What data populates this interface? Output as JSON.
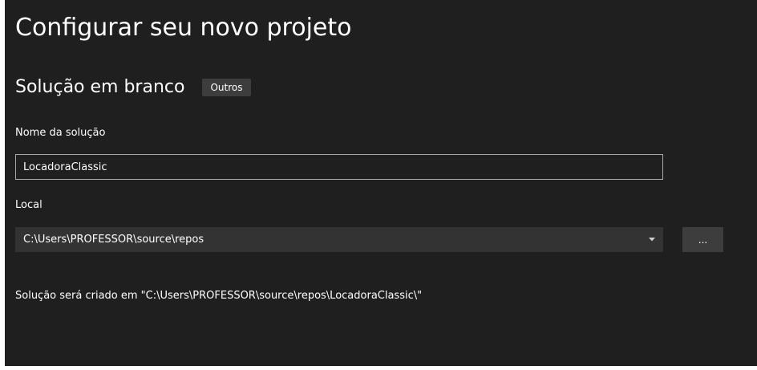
{
  "dialog": {
    "title": "Configurar seu novo projeto",
    "template_name": "Solução em branco",
    "template_tag": "Outros"
  },
  "solution_name": {
    "label": "Nome da solução",
    "value": "LocadoraClassic"
  },
  "location": {
    "label": "Local",
    "value": "C:\\Users\\PROFESSOR\\source\\repos",
    "dropdown_icon": "chevron-down-icon",
    "browse_label": "..."
  },
  "summary": {
    "text": "Solução será criado em \"C:\\Users\\PROFESSOR\\source\\repos\\LocadoraClassic\\\""
  },
  "colors": {
    "background": "#1f1f1f",
    "input_border": "#a8a8a8",
    "combo_background": "#333333",
    "tag_background": "#3d3d3d",
    "text": "#ffffff"
  }
}
